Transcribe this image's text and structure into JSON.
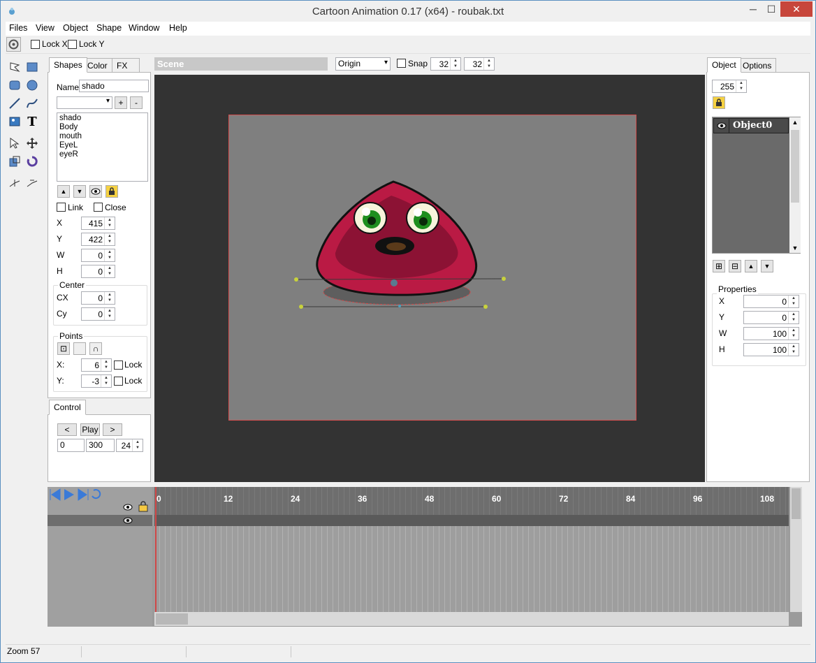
{
  "window": {
    "title": "Cartoon Animation 0.17 (x64) - roubak.txt",
    "minimize": "─",
    "maximize": "☐",
    "close": "✕"
  },
  "menu": [
    "Files",
    "View",
    "Object",
    "Shape",
    "Window",
    "Help"
  ],
  "toolbar": {
    "lock_x": "Lock X",
    "lock_y": "Lock Y"
  },
  "left_tabs": [
    "Shapes",
    "Color",
    "FX"
  ],
  "shape": {
    "name_label": "Name",
    "name_value": "shado",
    "add": "+",
    "remove": "-",
    "list": [
      "shado",
      "Body",
      "mouth",
      "EyeL",
      "eyeR"
    ],
    "link": "Link",
    "close": "Close",
    "fields": [
      {
        "label": "X",
        "value": "415"
      },
      {
        "label": "Y",
        "value": "422"
      },
      {
        "label": "W",
        "value": "0"
      },
      {
        "label": "H",
        "value": "0"
      }
    ],
    "center_label": "Center",
    "center": [
      {
        "label": "CX",
        "value": "0"
      },
      {
        "label": "Cy",
        "value": "0"
      }
    ],
    "points_label": "Points",
    "points": [
      {
        "label": "X:",
        "value": "6",
        "lock": "Lock"
      },
      {
        "label": "Y:",
        "value": "-3",
        "lock": "Lock"
      }
    ]
  },
  "control": {
    "tab": "Control",
    "prev": "<",
    "play": "Play",
    "next": ">",
    "start": "0",
    "end": "300",
    "fps": "24"
  },
  "scene": {
    "title": "Scene",
    "origin": "Origin",
    "snap": "Snap",
    "grid_x": "32",
    "grid_y": "32"
  },
  "right_tabs": [
    "Object",
    "Options"
  ],
  "object": {
    "alpha": "255",
    "item": "Object0",
    "properties_label": "Properties",
    "props": [
      {
        "label": "X",
        "value": "0"
      },
      {
        "label": "Y",
        "value": "0"
      },
      {
        "label": "W",
        "value": "100"
      },
      {
        "label": "H",
        "value": "100"
      }
    ]
  },
  "timeline": {
    "ticks": [
      "0",
      "12",
      "24",
      "36",
      "48",
      "60",
      "72",
      "84",
      "96",
      "108"
    ]
  },
  "status": {
    "zoom": "Zoom 57"
  },
  "colors": {
    "body": "#BA1A44",
    "body_inner": "#8C1234",
    "eye_iris": "#1E8E1E",
    "stage": "#7F7F7F",
    "viewport": "#333333",
    "handle": "#C8D23C"
  }
}
